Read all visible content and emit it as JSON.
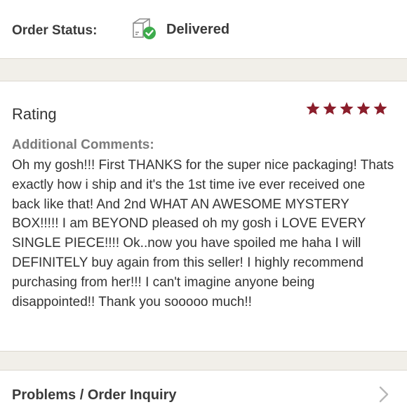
{
  "order_status": {
    "label": "Order Status:",
    "value": "Delivered",
    "icon": "package-delivered-icon",
    "check_color": "#3dab4c"
  },
  "rating": {
    "title": "Rating",
    "stars": 5,
    "max_stars": 5,
    "star_color": "#8b1e2b",
    "comments_label": "Additional Comments:",
    "comment": "Oh my gosh!!! First THANKS for the super nice packaging! Thats exactly how i ship and it's the 1st time ive ever received one back like that! And 2nd WHAT AN AWESOME MYSTERY BOX!!!!! I am BEYOND pleased oh my gosh i LOVE EVERY SINGLE PIECE!!!! Ok..now you have spoiled me haha I will DEFINITELY buy again from this seller! I highly recommend purchasing from her!!! I can't imagine anyone being disappointed!! Thank you sooooo much!!"
  },
  "inquiry": {
    "label": "Problems / Order Inquiry",
    "icon": "chevron-right-icon"
  }
}
